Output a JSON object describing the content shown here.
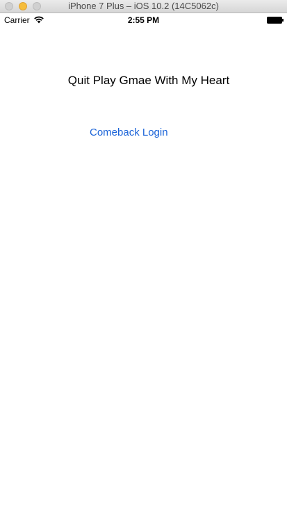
{
  "window": {
    "title": "iPhone 7 Plus – iOS 10.2 (14C5062c)"
  },
  "status_bar": {
    "carrier": "Carrier",
    "time": "2:55 PM",
    "icons": [
      "wifi-icon",
      "battery-icon"
    ]
  },
  "screen": {
    "message": "Quit Play Gmae With My Heart",
    "comeback_button_label": "Comeback Login"
  },
  "colors": {
    "link": "#1a63d8",
    "text": "#000000",
    "background": "#ffffff"
  }
}
